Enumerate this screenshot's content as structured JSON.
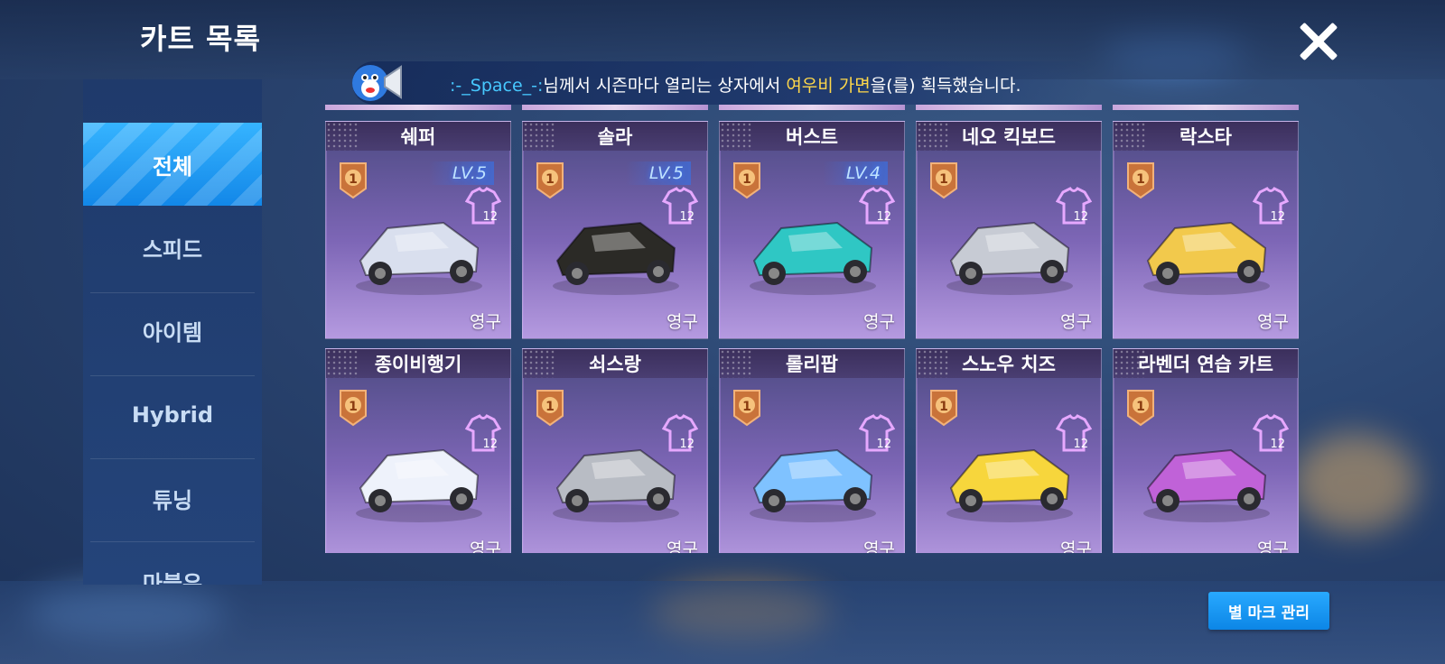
{
  "header": {
    "title": "카트 목록"
  },
  "notice": {
    "user": ":-_Space_-:",
    "text_before": "님께서 시즌마다 열리는 상자에서 ",
    "item": "여우비 가면",
    "text_after": "을(를) 획득했습니다."
  },
  "sidebar": {
    "items": [
      {
        "label": "전체",
        "active": true
      },
      {
        "label": "스피드"
      },
      {
        "label": "아이템"
      },
      {
        "label": "Hybrid"
      },
      {
        "label": "튜닝"
      },
      {
        "label": "마블유"
      }
    ]
  },
  "karts": [
    {
      "name": "쉐퍼",
      "level": "LV.5",
      "rank": "1",
      "shirt": "12",
      "status": "영구",
      "color": "#d9dfee"
    },
    {
      "name": "솔라",
      "level": "LV.5",
      "rank": "1",
      "shirt": "12",
      "status": "영구",
      "color": "#2b2a26"
    },
    {
      "name": "버스트",
      "level": "LV.4",
      "rank": "1",
      "shirt": "12",
      "status": "영구",
      "color": "#2fc7c4"
    },
    {
      "name": "네오 킥보드",
      "level": "",
      "rank": "1",
      "shirt": "12",
      "status": "영구",
      "color": "#c7cbd4"
    },
    {
      "name": "락스타",
      "level": "",
      "rank": "1",
      "shirt": "12",
      "status": "영구",
      "color": "#f2c94c"
    },
    {
      "name": "종이비행기",
      "level": "",
      "rank": "1",
      "shirt": "12",
      "status": "영구",
      "color": "#eef2fb"
    },
    {
      "name": "쇠스랑",
      "level": "",
      "rank": "1",
      "shirt": "12",
      "status": "영구",
      "color": "#b8bcc4"
    },
    {
      "name": "롤리팝",
      "level": "",
      "rank": "1",
      "shirt": "12",
      "status": "영구",
      "color": "#7fc2ff"
    },
    {
      "name": "스노우 치즈",
      "level": "",
      "rank": "1",
      "shirt": "12",
      "status": "영구",
      "color": "#f7d63c"
    },
    {
      "name": "라벤더 연습 카트",
      "level": "",
      "rank": "1",
      "shirt": "12",
      "status": "영구",
      "color": "#c062d8"
    }
  ],
  "footer": {
    "manage_label": "별 마크 관리"
  }
}
